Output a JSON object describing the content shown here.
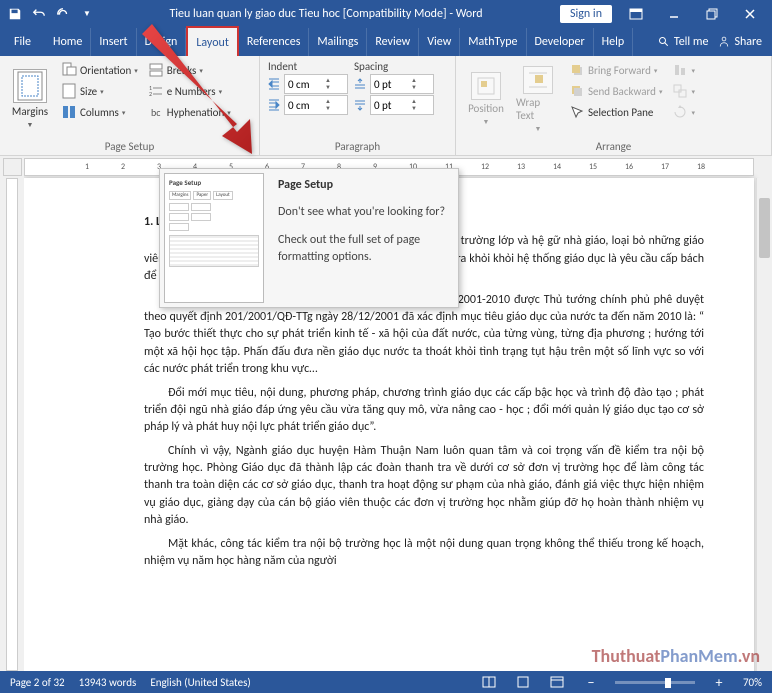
{
  "title": "Tieu luan quan ly giao duc Tieu hoc [Compatibility Mode]  -  Word",
  "signin": "Sign in",
  "tabs": {
    "file": "File",
    "home": "Home",
    "insert": "Insert",
    "design": "Design",
    "layout": "Layout",
    "references": "References",
    "mailings": "Mailings",
    "review": "Review",
    "view": "View",
    "mathtype": "MathType",
    "developer": "Developer",
    "help": "Help"
  },
  "tellme": "Tell me",
  "share": "Share",
  "ribbon": {
    "margins": "Margins",
    "orientation": "Orientation",
    "size": "Size",
    "columns": "Columns",
    "breaks": "Breaks",
    "lineNumbers": "Line Numbers",
    "hyphenation": "Hyphenation",
    "pageSetup": "Page Setup",
    "indent": "Indent",
    "spacing": "Spacing",
    "paragraph": "Paragraph",
    "indentLeft": "0 cm",
    "indentRight": "0 cm",
    "spaceBefore": "0 pt",
    "spaceAfter": "0 pt",
    "position": "Position",
    "wrapText": "Wrap Text",
    "bringForward": "Bring Forward",
    "sendBackward": "Send Backward",
    "selectionPane": "Selection Pane",
    "arrange": "Arrange"
  },
  "tooltip": {
    "title": "Page Setup",
    "line1": "Don't see what you're looking for?",
    "line2": "Check out the full set of page formatting options."
  },
  "doc": {
    "h1": "1. Lý do c",
    "p1a": "Ng              ã nhấn mạnh nhiề              hời kỳ đẩy mạnh               ực chất lượng toàn               trường lớp và hệ               gữ nhà giáo, loại bỏ những giáo viên yếu kém về phẩm chất, đạo đức và chuyên môn nghiệp vụ ra khỏi khỏi hệ thống giáo dục là yêu cầu cấp bách để giáo dục phát triển.",
    "p2": "Chiến lược phát triển giáo dục thời kỳ phát triển từ năm 2001-2010 được Thủ tướng chính phủ phê duyệt theo quyết định 201/2001/QĐ-TTg ngày 28/12/2001 đã xác định mục tiêu giáo dục của nước ta đến năm 2010 là: “ Tạo bước thiết thực cho sự phát triển kinh tế - xã hội của đất nước, của từng vùng, từng địa phương ; hướng tới một xã hội học tập. Phấn đấu đưa nền giáo dục nước ta thoát khỏi tình trạng tụt hậu trên một số lĩnh vực so với các nước phát triển trong khu vực…",
    "p3": "Đổi mới mục tiêu, nội dung, phương pháp, chương trình giáo dục các cấp bậc học và trình độ đào tạo ; phát triển đội ngũ nhà giáo đáp ứng yêu cầu vừa tăng quy mô, vừa nâng cao - học ; đổi mới quản lý giáo dục tạo cơ sở pháp lý và phát huy nội lực phát triển giáo dục”.",
    "p4": "Chính vì vậy, Ngành giáo dục huyện Hàm Thuận Nam luôn quan tâm và coi trọng vấn đề kiểm tra nội bộ trường học. Phòng Giáo dục đã thành lập các đoàn thanh tra về dưới cơ sở đơn vị trường học để làm công tác thanh tra toàn diện các cơ sở giáo dục, thanh tra hoạt động sư phạm của nhà    giáo, đánh giá việc thực hiện nhiệm vụ giáo dục, giảng dạy của cán bộ giáo viên thuộc các đơn vị trường học nhằm giúp đỡ họ hoàn thành nhiệm vụ nhà giáo.",
    "p5": "Mặt khác, công tác kiểm tra nội bộ trường học là một nội dung quan trọng không thể thiếu trong kế hoạch, nhiệm vụ năm học hàng năm của người"
  },
  "ruler": {
    "nums": [
      "1",
      "2",
      "3",
      "4",
      "5",
      "6",
      "7",
      "8",
      "9",
      "10",
      "11",
      "12",
      "13",
      "14",
      "15",
      "16",
      "17",
      "18"
    ]
  },
  "status": {
    "page": "Page 2 of 32",
    "words": "13943 words",
    "lang": "English (United States)",
    "zoom": "70%"
  },
  "watermark1": "Thuthuat",
  "watermark2": "PhanMem",
  "watermark3": ".vn"
}
